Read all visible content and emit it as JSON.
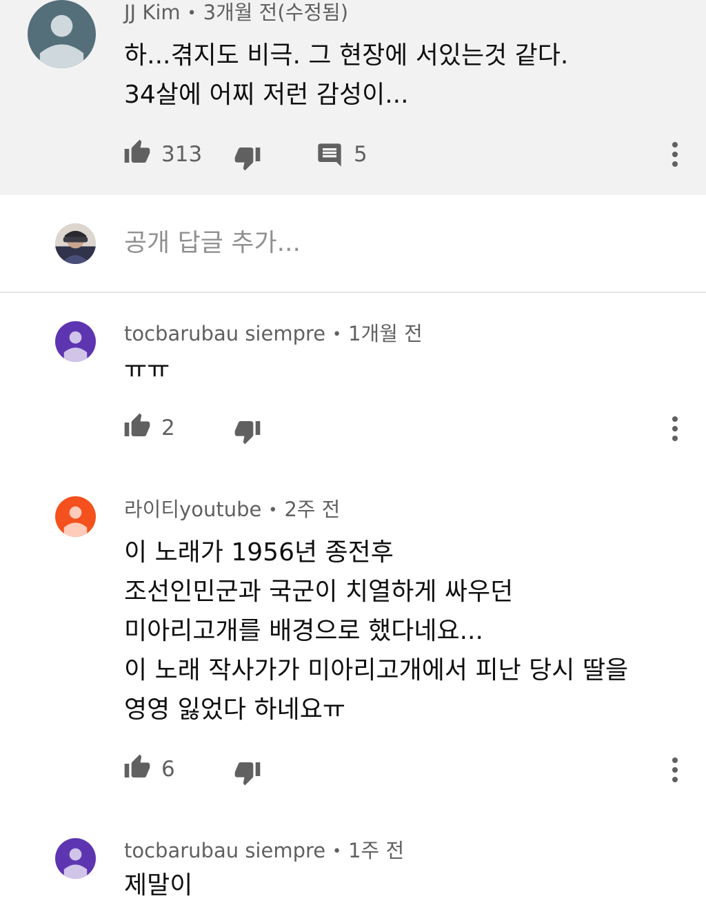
{
  "top_comment": {
    "author": "JJ Kim",
    "time": "3개월 전(수정됨)",
    "lines": [
      "하...겪지도 비극. 그 현장에 서있는것 같다.",
      "34살에 어찌 저런 감성이..."
    ],
    "likes": "313",
    "replies": "5",
    "avatar_color": "#546e7a"
  },
  "reply_box": {
    "placeholder": "공개 답글 추가..."
  },
  "separator": "•",
  "replies": [
    {
      "author": "tocbarubau siempre",
      "time": "1개월 전",
      "lines": [
        "ㅠㅠ"
      ],
      "likes": "2",
      "avatar_color": "#5e35b1"
    },
    {
      "author": "라이티youtube",
      "time": "2주 전",
      "lines": [
        "이 노래가 1956년 종전후",
        "조선인민군과 국군이 치열하게 싸우던",
        "미아리고개를 배경으로 했다네요...",
        "이 노래 작사가가 미아리고개에서 피난 당시 딸을",
        "영영 잃었다 하네요ㅠ"
      ],
      "likes": "6",
      "avatar_color": "#f4511e"
    },
    {
      "author": "tocbarubau siempre",
      "time": "1주 전",
      "lines": [
        "제말이"
      ],
      "avatar_color": "#5e35b1"
    }
  ],
  "icons": {
    "like": "thumbs-up-icon",
    "dislike": "thumbs-down-icon",
    "reply": "comment-icon",
    "more": "more-vert-icon"
  }
}
